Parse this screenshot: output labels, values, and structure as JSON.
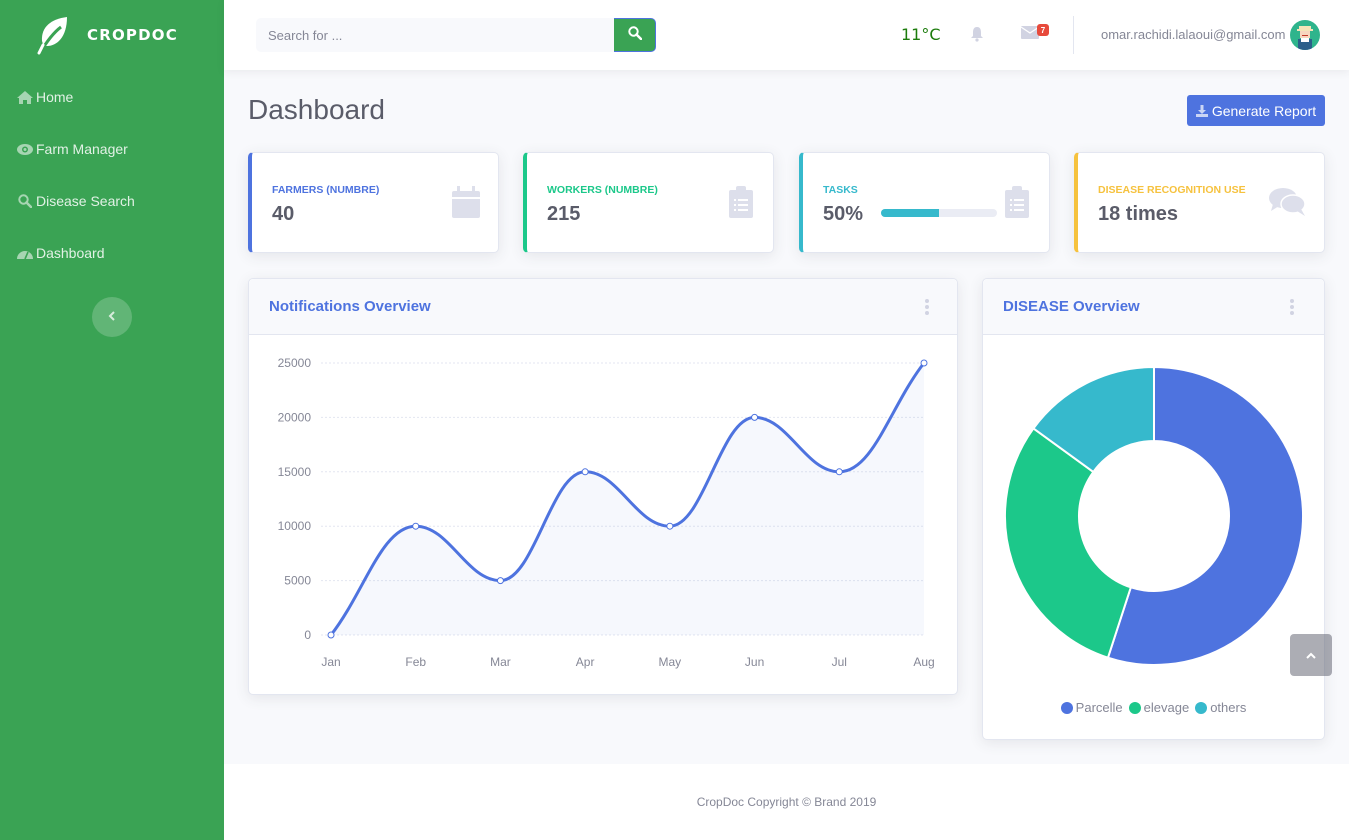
{
  "sidebar": {
    "brand": "CROPDOC",
    "brand_icon": "leaf-icon",
    "items": [
      {
        "label": "Home",
        "icon": "home-icon"
      },
      {
        "label": "Farm Manager",
        "icon": "eye-icon"
      },
      {
        "label": "Disease Search",
        "icon": "search-icon"
      },
      {
        "label": "Dashboard",
        "icon": "tachometer-icon"
      }
    ],
    "toggle_icon": "chevron-left-icon"
  },
  "topbar": {
    "search": {
      "placeholder": "Search for ...",
      "value": ""
    },
    "temperature": "11°C",
    "alerts_icon": "bell-icon",
    "messages_icon": "envelope-icon",
    "messages_count": "7",
    "user_email": "omar.rachidi.lalaoui@gmail.com",
    "avatar_icon": "farmer-avatar"
  },
  "page": {
    "title": "Dashboard",
    "generate_report_label": "Generate Report"
  },
  "stats": [
    {
      "label": "FARMERS (NUMBRE)",
      "value": "40",
      "color": "#4e73df",
      "icon": "calendar-icon"
    },
    {
      "label": "WORKERS (NUMBRE)",
      "value": "215",
      "color": "#1cc88a",
      "icon": "clipboard-list-icon"
    },
    {
      "label": "TASKS",
      "value": "50%",
      "progress": 0.5,
      "color": "#36b9cc",
      "icon": "clipboard-list-icon"
    },
    {
      "label": "DISEASE RECOGNITION USE",
      "value": "18 times",
      "color": "#f6c23e",
      "icon": "comments-icon"
    }
  ],
  "notifications_card": {
    "title": "Notifications Overview"
  },
  "disease_card": {
    "title": "DISEASE Overview"
  },
  "footer": {
    "text": "CropDoc Copyright © Brand 2019"
  },
  "chart_data": [
    {
      "type": "area",
      "title": "Notifications Overview",
      "categories": [
        "Jan",
        "Feb",
        "Mar",
        "Apr",
        "May",
        "Jun",
        "Jul",
        "Aug"
      ],
      "series": [
        {
          "name": "Notifications",
          "values": [
            0,
            10000,
            5000,
            15000,
            10000,
            20000,
            15000,
            25000
          ],
          "color": "#4e73df"
        }
      ],
      "yticks": [
        "0",
        "5000",
        "10000",
        "15000",
        "20000",
        "25000"
      ],
      "ylim": [
        0,
        25000
      ],
      "grid": true,
      "xlabel": "",
      "ylabel": ""
    },
    {
      "type": "pie",
      "title": "DISEASE Overview",
      "categories": [
        "Parcelle",
        "elevage",
        "others"
      ],
      "values": [
        55,
        30,
        15
      ],
      "colors": [
        "#4e73df",
        "#1cc88a",
        "#36b9cc"
      ],
      "legend": "bottom"
    }
  ]
}
